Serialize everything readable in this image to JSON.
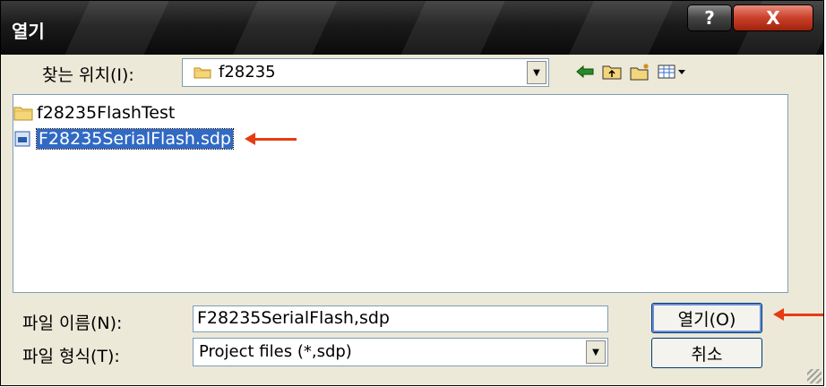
{
  "window": {
    "title": "열기"
  },
  "toolbar": {
    "look_in_label": "찾는 위치(I):",
    "look_in_value": "f28235"
  },
  "file_list": {
    "items": [
      {
        "name": "f28235FlashTest",
        "icon": "folder-icon"
      },
      {
        "name": "F28235SerialFlash.sdp",
        "icon": "sdp-file-icon"
      }
    ]
  },
  "form": {
    "file_name_label": "파일 이름(N):",
    "file_name_value": "F28235SerialFlash,sdp",
    "file_type_label": "파일 형식(T):",
    "file_type_value": "Project files (*,sdp)"
  },
  "buttons": {
    "open": "열기(O)",
    "cancel": "취소",
    "help": "?",
    "close": "X"
  },
  "colors": {
    "selection": "#316ac5",
    "annotation_arrow": "#e63c14",
    "dialog_bg": "#ece9d8"
  }
}
